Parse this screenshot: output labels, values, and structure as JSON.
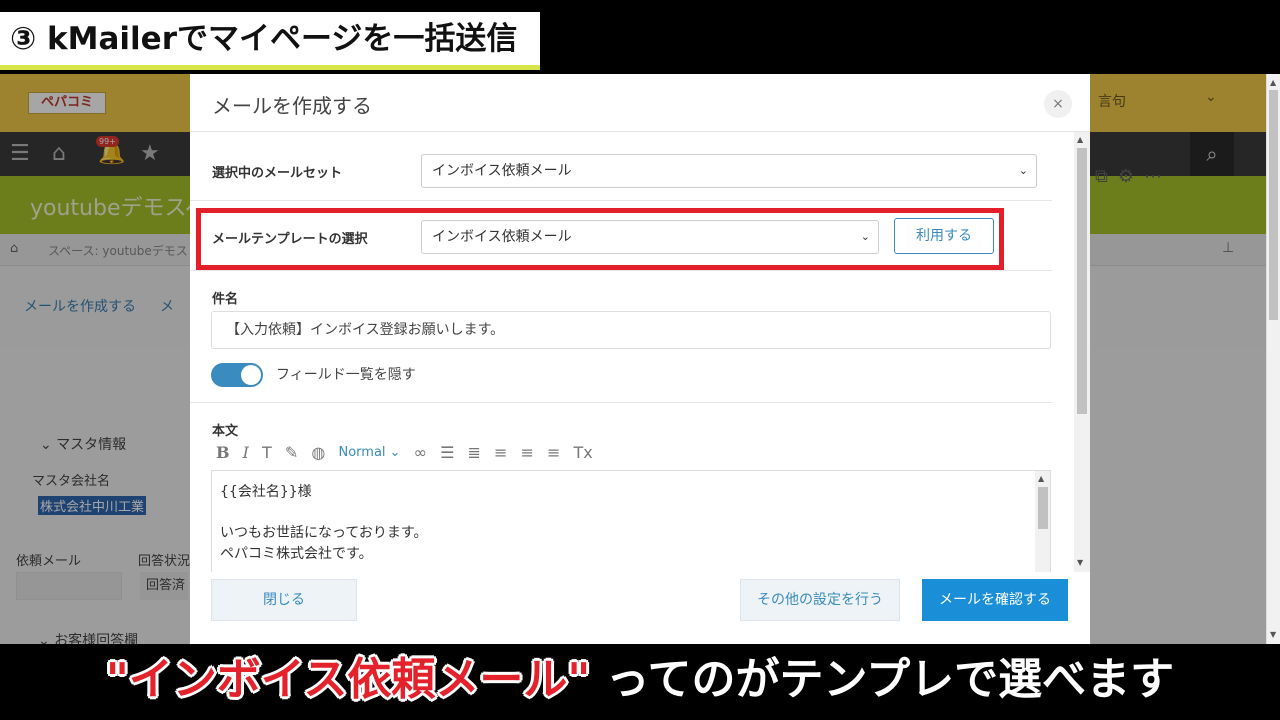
{
  "banner": {
    "step_label": "③ kMailerでマイページを一括送信"
  },
  "app": {
    "logo_text": "ペパコミ",
    "badge": "99+",
    "search_label": "言句",
    "space_title": "youtubeデモスペ",
    "breadcrumb": "スペース: youtubeデモス",
    "actions": {
      "compose": "メールを作成する",
      "compose2": "メ"
    },
    "master": {
      "section": "マスタ情報",
      "company_label": "マスタ会社名",
      "company_value": "株式会社中川工業",
      "request_mail_label": "依頼メール",
      "answer_status_label": "回答状況",
      "answer_status_value": "回答済",
      "customer_answer": "お客様回答欄"
    }
  },
  "modal": {
    "title": "メールを作成する",
    "close_icon": "×",
    "mail_set": {
      "label": "選択中のメールセット",
      "value": "インボイス依頼メール"
    },
    "template": {
      "label": "メールテンプレートの選択",
      "value": "インボイス依頼メール",
      "use_button": "利用する"
    },
    "subject": {
      "label": "件名",
      "value": "【入力依頼】インボイス登録お願いします。"
    },
    "toggle": {
      "label": "フィールド一覧を隠す",
      "on": true
    },
    "body": {
      "label": "本文",
      "format": "Normal",
      "lines": [
        "{{会社名}}様",
        "",
        "いつもお世話になっております。",
        "ペパコミ株式会社です。"
      ]
    },
    "footer": {
      "close": "閉じる",
      "other_settings": "その他の設定を行う",
      "confirm": "メールを確認する"
    }
  },
  "caption": {
    "highlight": "\"インボイス依頼メール\"",
    "rest": " ってのがテンプレで選べます"
  },
  "colors": {
    "primary": "#3a8bbf",
    "confirm": "#1a8fd8",
    "highlight_box": "#e3202a",
    "header_yellow": "#f2c84a",
    "space_green": "#a6c22b"
  }
}
